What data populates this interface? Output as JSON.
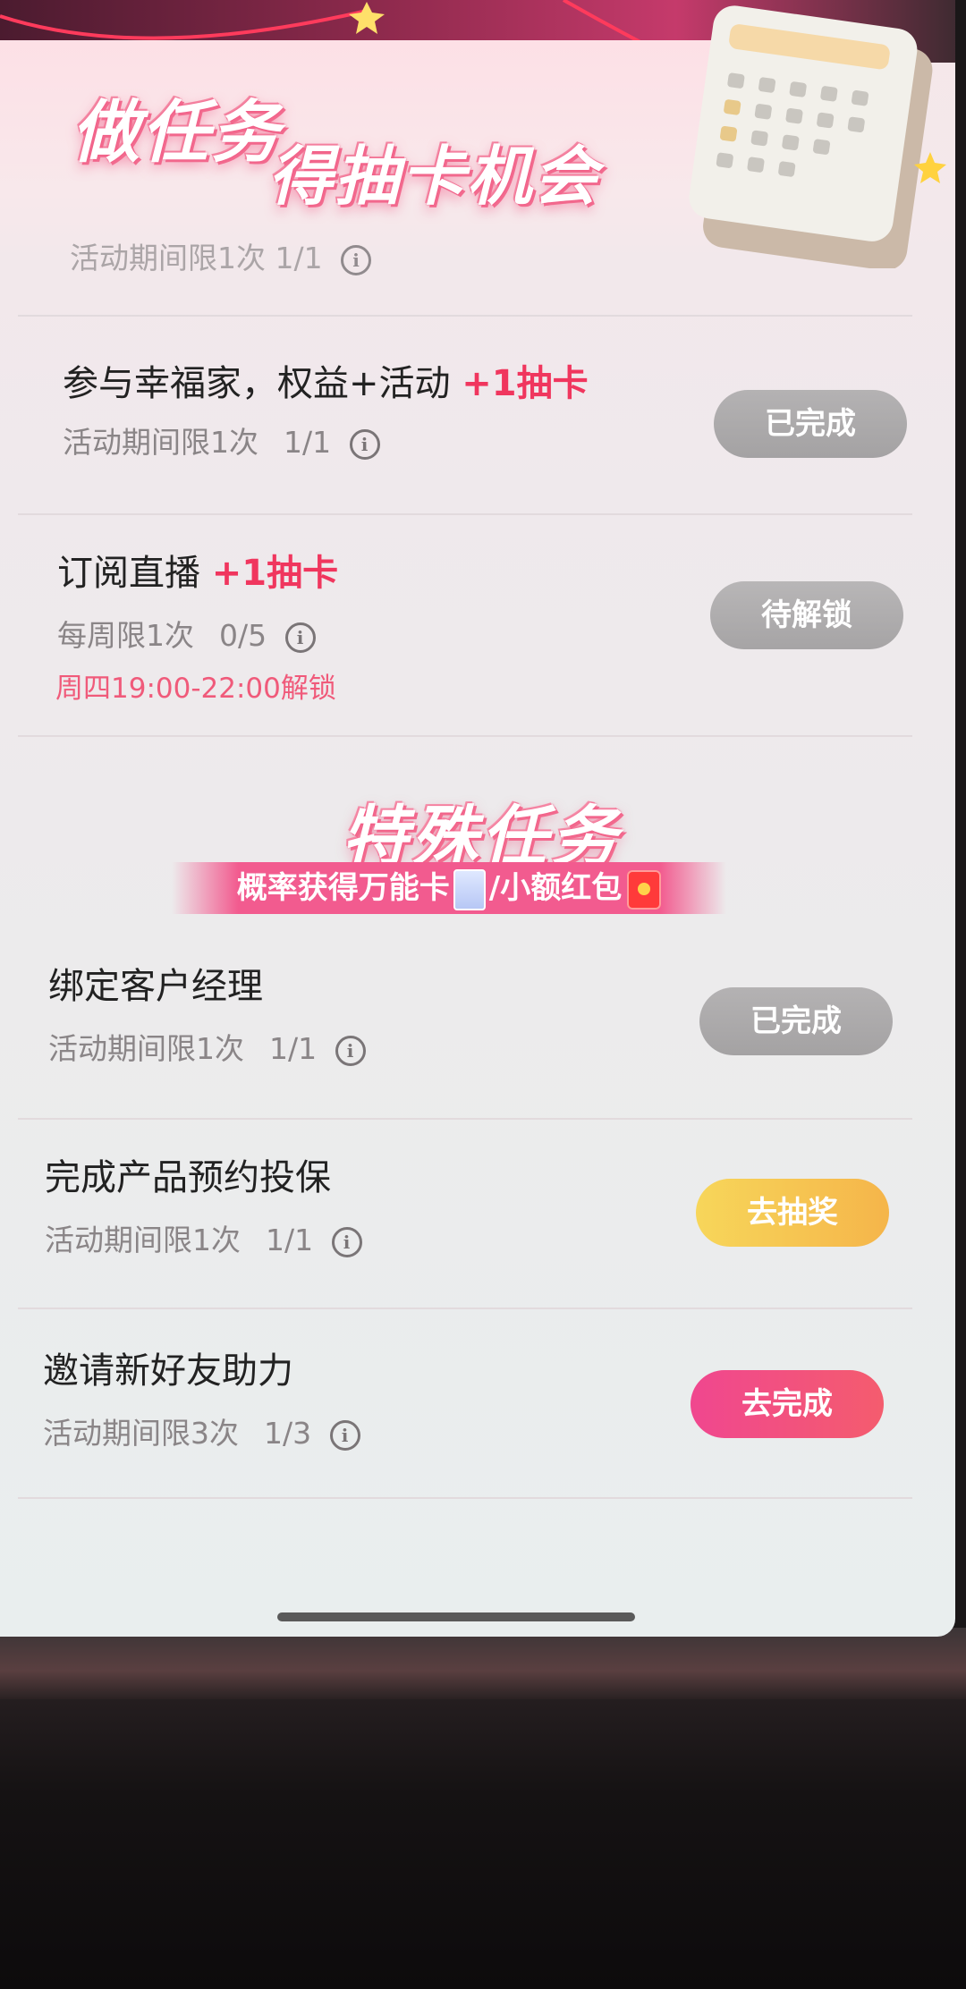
{
  "header": {
    "title_part1": "做任务",
    "title_part2": "得抽卡机会",
    "partial_meta": "活动期间限1次  1/1"
  },
  "tasks": [
    {
      "title": "参与幸福家，权益+活动",
      "reward": "+1抽卡",
      "limit": "活动期间限1次",
      "progress": "1/1",
      "button": "已完成",
      "note": ""
    },
    {
      "title": "订阅直播",
      "reward": "+1抽卡",
      "limit": "每周限1次",
      "progress": "0/5",
      "button": "待解锁",
      "note": "周四19:00-22:00解锁"
    }
  ],
  "special": {
    "title": "特殊任务",
    "banner_part1": "概率获得万能卡",
    "banner_part2": "/小额红包",
    "tasks": [
      {
        "title": "绑定客户经理",
        "limit": "活动期间限1次",
        "progress": "1/1",
        "button": "已完成"
      },
      {
        "title": "完成产品预约投保",
        "limit": "活动期间限1次",
        "progress": "1/1",
        "button": "去抽奖"
      },
      {
        "title": "邀请新好友助力",
        "limit": "活动期间限3次",
        "progress": "1/3",
        "button": "去完成"
      }
    ]
  },
  "icons": {
    "info": "info-icon",
    "calendar": "calendar-icon",
    "card": "wildcard-icon",
    "red_packet": "red-packet-icon"
  },
  "colors": {
    "accent_pink": "#f0365e",
    "done_gray": "#aaa8a9",
    "draw_yellow": "#f6c24f",
    "go_pink": "#f14d84"
  }
}
